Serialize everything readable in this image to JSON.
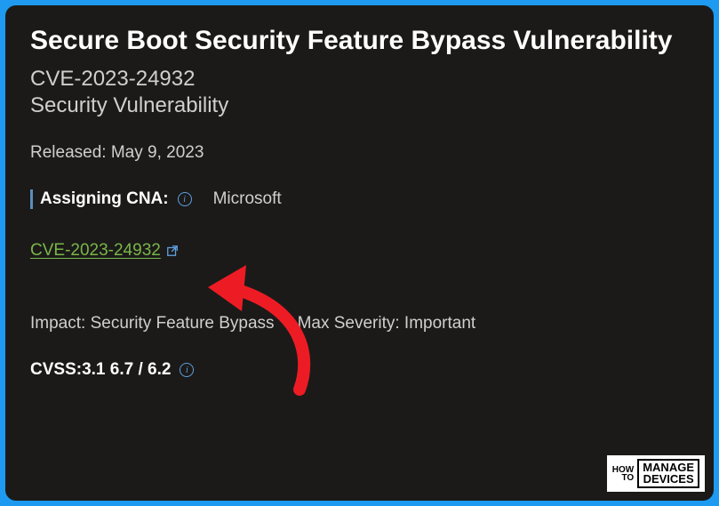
{
  "title": "Secure Boot Security Feature Bypass Vulnerability",
  "cve_id": "CVE-2023-24932",
  "vuln_type": "Security Vulnerability",
  "released_label": "Released: May 9, 2023",
  "cna": {
    "label": "Assigning CNA:",
    "value": "Microsoft"
  },
  "cve_link": {
    "text": "CVE-2023-24932"
  },
  "impact": {
    "label": "Impact: Security Feature Bypass"
  },
  "severity": {
    "label": "Max Severity: Important"
  },
  "cvss": {
    "label": "CVSS:3.1 6.7 / 6.2"
  },
  "logo": {
    "how": "HOW",
    "to": "TO",
    "manage": "MANAGE",
    "devices": "DEVICES"
  }
}
